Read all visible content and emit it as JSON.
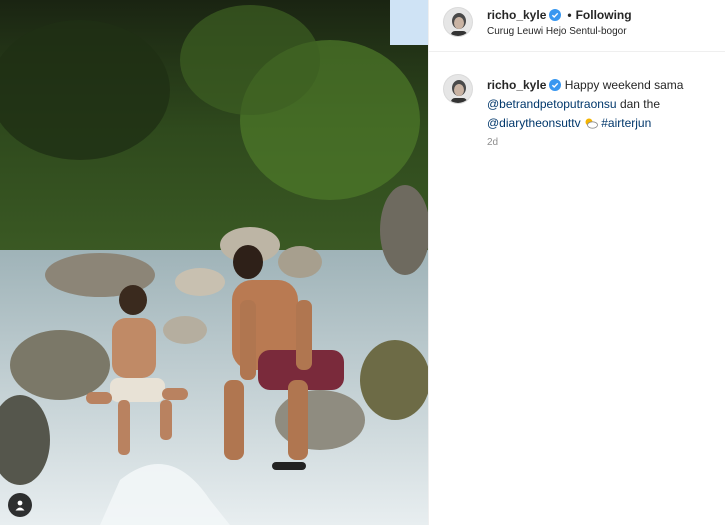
{
  "post": {
    "username": "richo_kyle",
    "follow_status": "Following",
    "location": "Curug Leuwi Hejo Sentul-bogor"
  },
  "caption": {
    "username": "richo_kyle",
    "text_1": "Happy weekend sama",
    "mention_1": "@betrandpetoputraonsu",
    "text_2": "dan the",
    "mention_2": "@diarytheonsuttv",
    "emoji": "sun-behind-cloud-icon",
    "hashtag": "#airterjun",
    "time": "2d"
  },
  "colors": {
    "link": "#00376b",
    "verified": "#3897f0",
    "secondary_text": "#8e8e8e"
  }
}
